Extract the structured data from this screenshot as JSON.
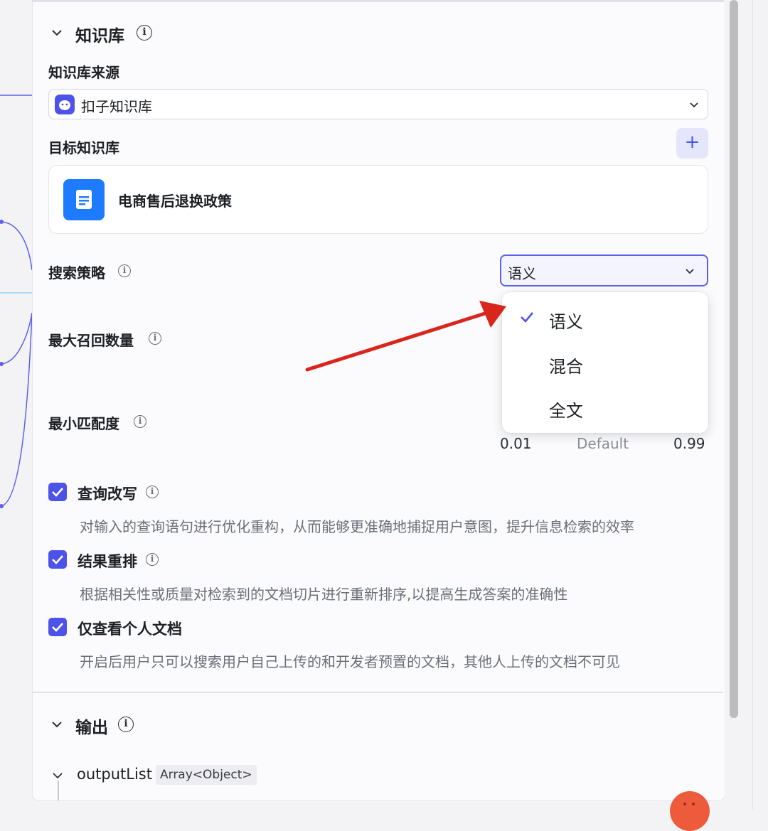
{
  "knowledge": {
    "section_title": "知识库",
    "source_label": "知识库来源",
    "source_value": "扣子知识库",
    "target_label": "目标知识库",
    "add_label": "+",
    "kb_item_name": "电商售后退换政策"
  },
  "search": {
    "strategy_label": "搜索策略",
    "strategy_value": "语义",
    "options": [
      "语义",
      "混合",
      "全文"
    ],
    "selected_option": "语义",
    "max_recall_label": "最大召回数量",
    "min_match_label": "最小匹配度",
    "min_match_range": {
      "min": "0.01",
      "default": "Default",
      "max": "0.99"
    }
  },
  "options": [
    {
      "label": "查询改写",
      "checked": true,
      "desc": "对输入的查询语句进行优化重构，从而能够更准确地捕捉用户意图，提升信息检索的效率"
    },
    {
      "label": "结果重排",
      "checked": true,
      "desc": "根据相关性或质量对检索到的文档切片进行重新排序,以提高生成答案的准确性"
    },
    {
      "label": "仅查看个人文档",
      "checked": true,
      "desc": "开启后用户只可以搜索用户自己上传的和开发者预置的文档，其他人上传的文档不可见"
    }
  ],
  "output": {
    "section_title": "输出",
    "item_name": "outputList",
    "item_type": "Array<Object>"
  },
  "icons": {
    "collapse": "chevron-down-icon",
    "info": "info-icon",
    "check": "check-icon",
    "doc": "document-icon",
    "source_logo": "coze-logo-icon"
  },
  "colors": {
    "accent": "#4d53e8",
    "doc_icon": "#1d7bff",
    "annotation_arrow": "#d9261c"
  }
}
